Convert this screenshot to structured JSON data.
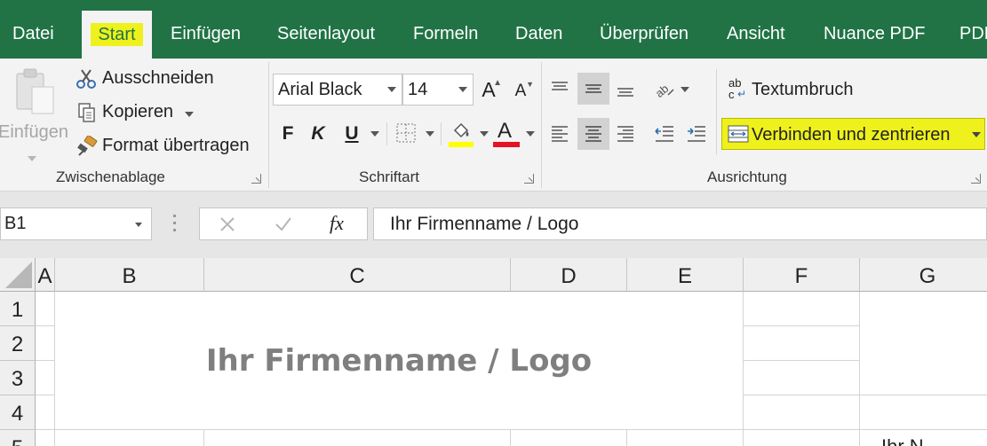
{
  "tabs": {
    "datei": "Datei",
    "start": "Start",
    "einfuegen": "Einfügen",
    "seitenlayout": "Seitenlayout",
    "formeln": "Formeln",
    "daten": "Daten",
    "ueberpruefen": "Überprüfen",
    "ansicht": "Ansicht",
    "nuance": "Nuance PDF",
    "pdf": "PDF"
  },
  "clipboard": {
    "paste": "Einfügen",
    "cut": "Ausschneiden",
    "copy": "Kopieren",
    "format_painter": "Format übertragen",
    "group_label": "Zwischenablage"
  },
  "font": {
    "family": "Arial Black",
    "size": "14",
    "bold": "F",
    "italic": "K",
    "underline": "U",
    "grow": "A",
    "shrink": "A",
    "color_letter": "A",
    "group_label": "Schriftart"
  },
  "alignment": {
    "wrap": "Textumbruch",
    "wrap_icon_top": "ab",
    "wrap_icon_bottom": "c",
    "merge": "Verbinden und zentrieren",
    "group_label": "Ausrichtung"
  },
  "formula_bar": {
    "name_box": "B1",
    "fx": "fx",
    "content": "Ihr Firmenname / Logo"
  },
  "grid": {
    "columns": [
      "A",
      "B",
      "C",
      "D",
      "E",
      "F",
      "G"
    ],
    "rows": [
      "1",
      "2",
      "3",
      "4",
      "5"
    ],
    "merged_cell_text": "Ihr Firmenname / Logo",
    "partial_text": "Ihr N"
  },
  "colors": {
    "ribbon_green": "#217346",
    "highlight_yellow": "#eef11c",
    "font_color_red": "#e81123",
    "fill_color_yellow": "#ffff00",
    "merged_text_gray": "#7f7f7f"
  }
}
